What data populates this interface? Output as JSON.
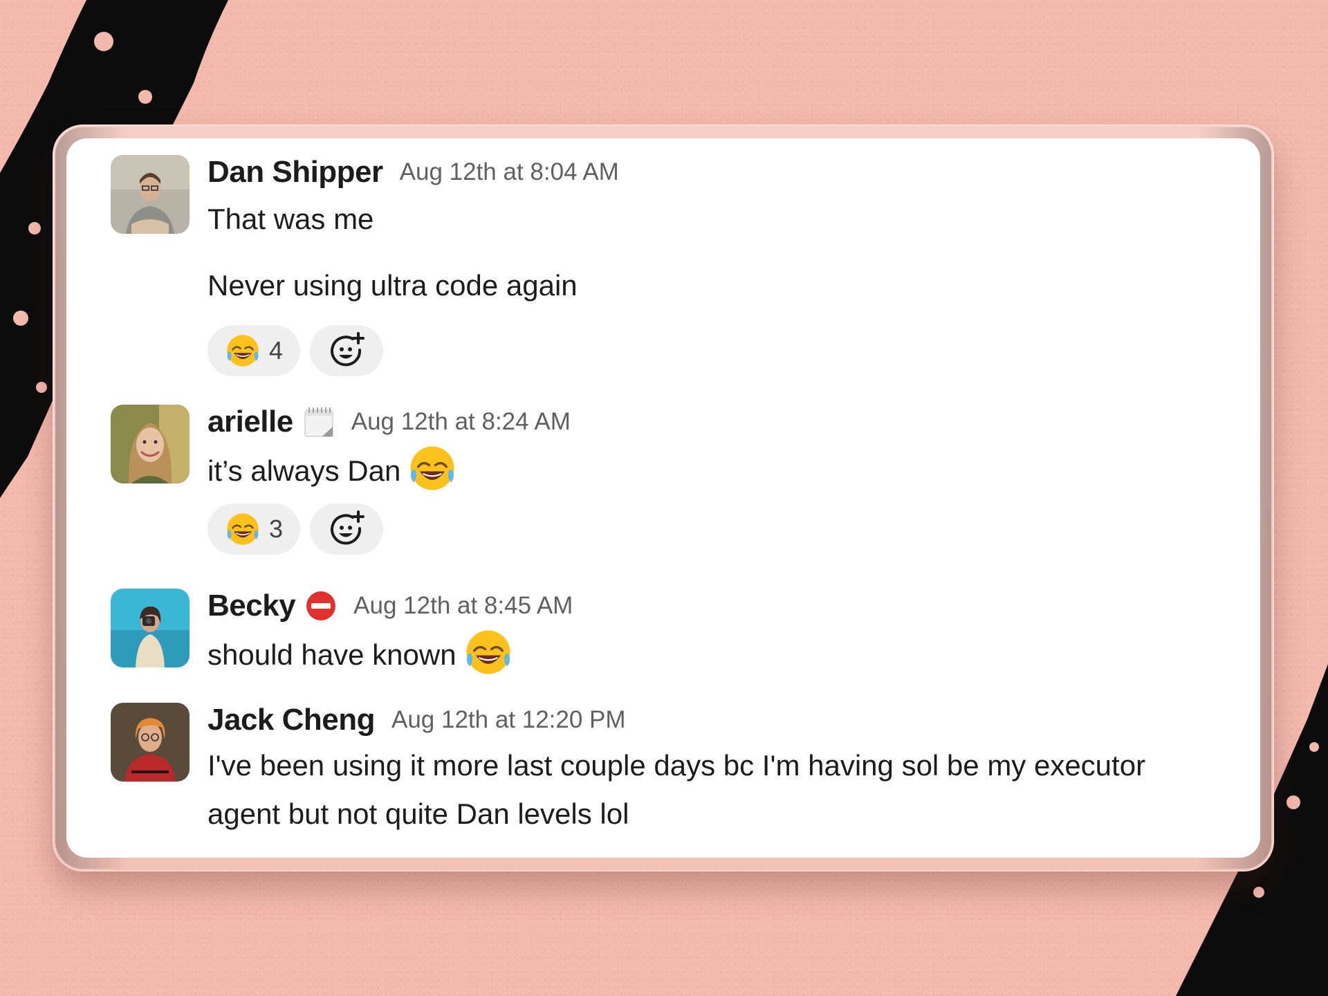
{
  "messages": [
    {
      "name": "Dan Shipper",
      "time": "Aug 12th at 8:04 AM",
      "lines": [
        "That was me",
        "Never using ultra code again"
      ],
      "reaction": {
        "emoji": "joy-emoji",
        "count": "4"
      }
    },
    {
      "name": "arielle",
      "status_icon": "calendar-icon",
      "time": "Aug 12th at 8:24 AM",
      "text": "it’s always Dan",
      "inline_emoji": "joy-emoji",
      "reaction": {
        "emoji": "joy-emoji",
        "count": "3"
      }
    },
    {
      "name": "Becky",
      "status_icon": "no-entry-icon",
      "time": "Aug 12th at 8:45 AM",
      "text": "should have known",
      "inline_emoji": "joy-emoji"
    },
    {
      "name": "Jack Cheng",
      "time": "Aug 12th at 12:20 PM",
      "lines": [
        "I've been using it more last couple days bc I'm having sol be my executor",
        "agent but not quite Dan levels lol"
      ]
    }
  ],
  "colors": {
    "background": "#f4b9ad",
    "card": "#ffffff",
    "text": "#1d1c1d",
    "timestamp": "#616061",
    "reaction_bg": "#f0efef"
  }
}
